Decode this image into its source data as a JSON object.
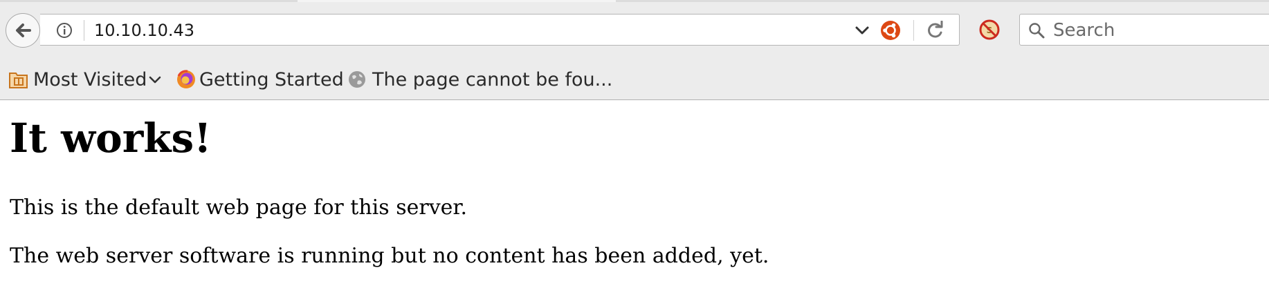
{
  "browser": {
    "url": "10.10.10.43",
    "search_placeholder": "Search",
    "icons": {
      "back": "back-arrow-icon",
      "info": "info-icon",
      "dropdown": "chevron-down-icon",
      "search_engine": "ubuntu-icon",
      "reload": "reload-icon",
      "noscript": "noscript-icon",
      "search": "search-icon"
    }
  },
  "bookmarks": [
    {
      "label": "Most Visited",
      "icon": "folder-icon",
      "has_dropdown": true
    },
    {
      "label": "Getting Started",
      "icon": "firefox-icon"
    },
    {
      "label": "The page cannot be fou...",
      "icon": "globe-icon"
    }
  ],
  "page": {
    "heading": "It works!",
    "paragraphs": [
      "This is the default web page for this server.",
      "The web server software is running but no content has been added, yet."
    ]
  },
  "colors": {
    "toolbar_bg": "#ececec",
    "ubuntu_orange": "#dd4814",
    "page_bg": "#ffffff"
  }
}
